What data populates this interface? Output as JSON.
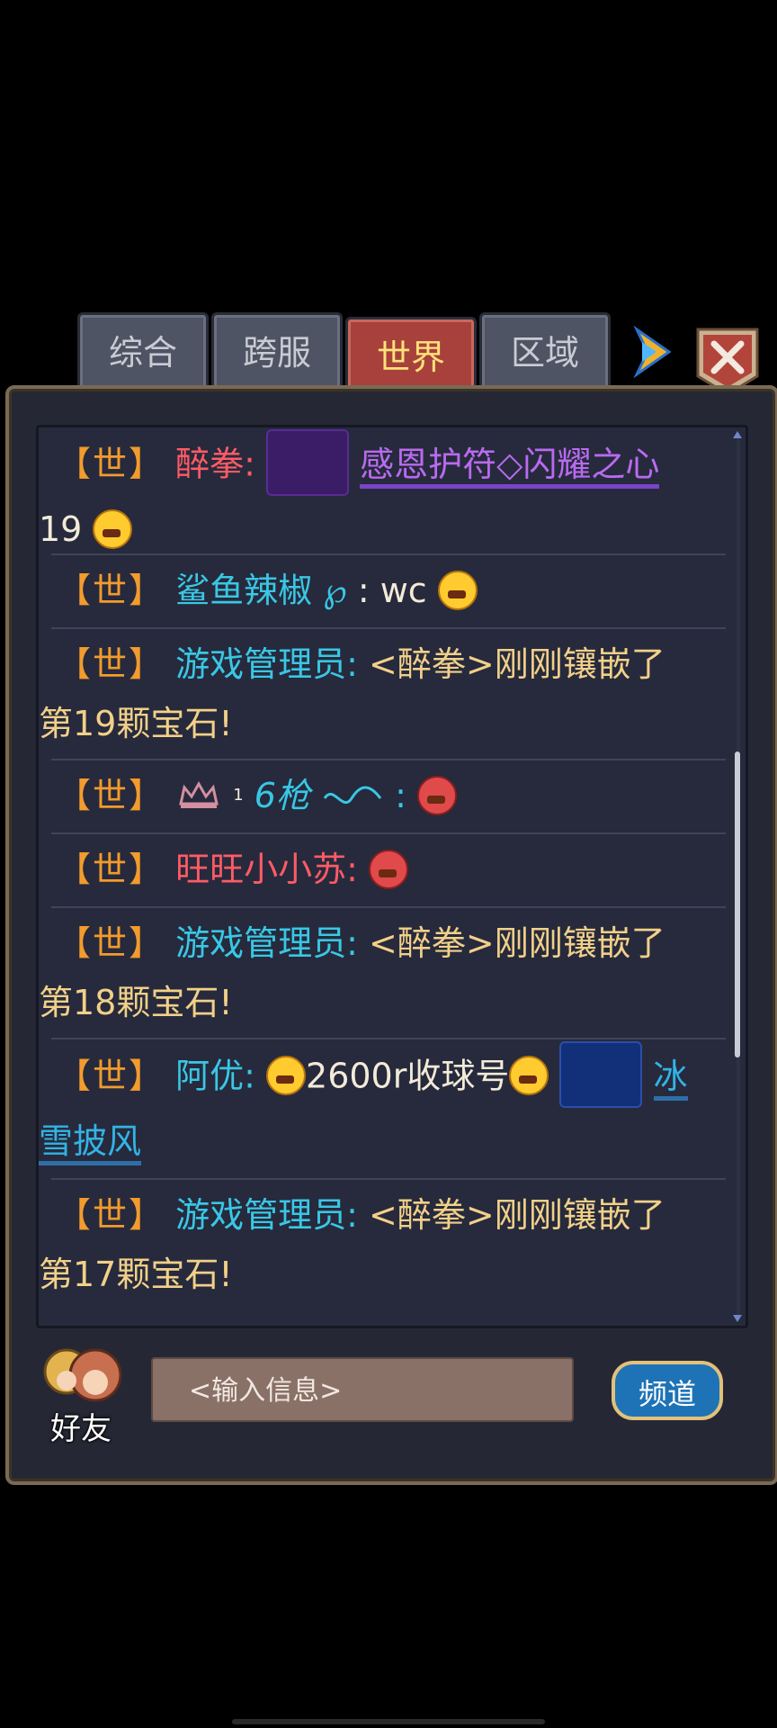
{
  "tabs": [
    "综合",
    "跨服",
    "世界",
    "区域"
  ],
  "active_tab": "世界",
  "channel_tag": "【世】",
  "messages": [
    {
      "name": "醉拳:",
      "item": "感恩护符◇闪耀之心",
      "continuation": "19"
    },
    {
      "name": "鲨鱼辣椒",
      "symbol": "℘",
      "text": ": wc"
    },
    {
      "name": "游戏管理员:",
      "text": " <醉拳>刚刚镶嵌了",
      "continuation": "第19颗宝石!"
    },
    {
      "badge": "1",
      "name": "6枪",
      "text": ":"
    },
    {
      "name": "旺旺小小苏:"
    },
    {
      "name": "游戏管理员:",
      "text": " <醉拳>刚刚镶嵌了",
      "continuation": "第18颗宝石!"
    },
    {
      "name": "阿优:",
      "text": "2600r收球号",
      "item_part1": "冰",
      "item_part2": "雪披风"
    },
    {
      "name": "游戏管理员:",
      "text": " <醉拳>刚刚镶嵌了",
      "continuation": "第17颗宝石!"
    }
  ],
  "input_placeholder": "<输入信息>",
  "friend_label": "好友",
  "channel_button": "频道",
  "colors": {
    "tag": "#f39b2c",
    "name_red": "#ff5b66",
    "name_cyan": "#39c7e5",
    "text_gold": "#f2d089",
    "link_purple": "#b96af0",
    "link_blue": "#33b3e6"
  }
}
